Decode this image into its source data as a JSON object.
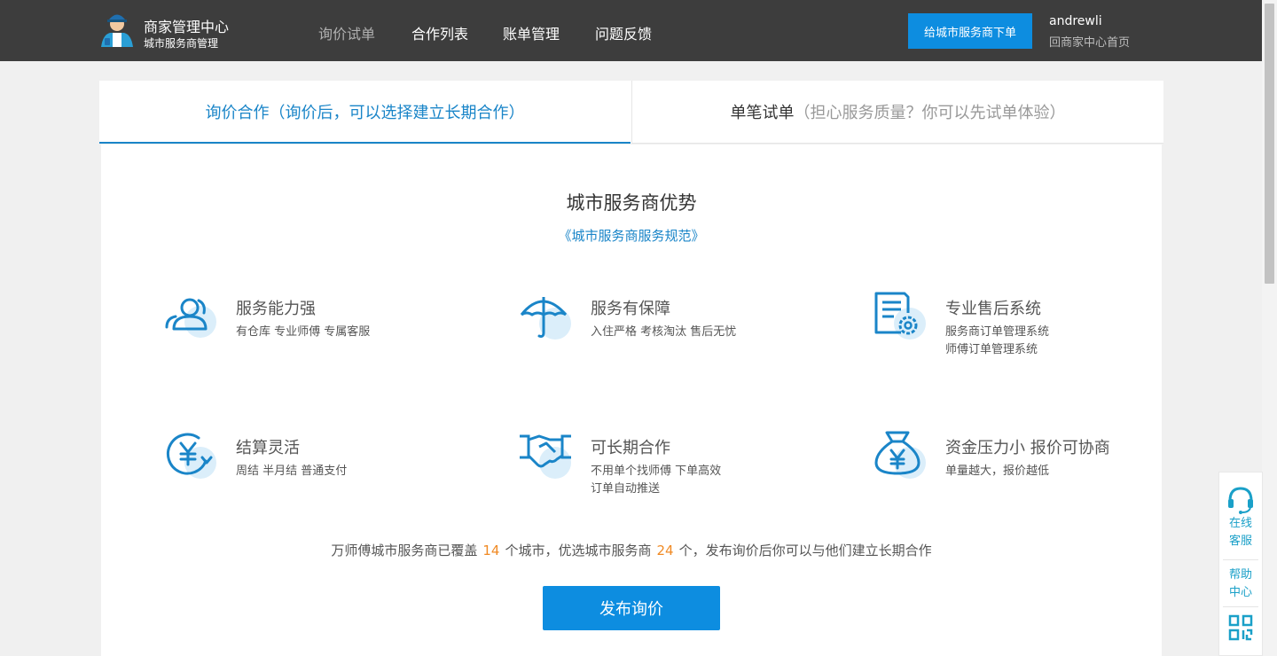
{
  "header": {
    "brand_title": "商家管理中心",
    "brand_subtitle": "城市服务商管理",
    "nav": [
      "询价试单",
      "合作列表",
      "账单管理",
      "问题反馈"
    ],
    "order_button": "给城市服务商下单",
    "username": "andrewli",
    "home_link": "回商家中心首页"
  },
  "tabs": [
    {
      "label": "询价合作（询价后，可以选择建立长期合作）",
      "note": ""
    },
    {
      "label": "单笔试单",
      "note": "（担心服务质量？你可以先试单体验）"
    }
  ],
  "panel": {
    "title": "城市服务商优势",
    "link": "《城市服务商服务规范》",
    "features": [
      {
        "icon": "users-icon",
        "title": "服务能力强",
        "desc": [
          "有仓库   专业师傅   专属客服"
        ]
      },
      {
        "icon": "umbrella-icon",
        "title": "服务有保障",
        "desc": [
          "入住严格   考核淘汰   售后无忧"
        ]
      },
      {
        "icon": "document-gear-icon",
        "title": "专业售后系统",
        "desc": [
          "服务商订单管理系统",
          "师傅订单管理系统"
        ]
      },
      {
        "icon": "yen-refresh-icon",
        "title": "结算灵活",
        "desc": [
          "周结   半月结   普通支付"
        ]
      },
      {
        "icon": "handshake-icon",
        "title": "可长期合作",
        "desc": [
          "不用单个找师傅   下单高效",
          "订单自动推送"
        ]
      },
      {
        "icon": "money-bag-icon",
        "title": "资金压力小 报价可协商",
        "desc": [
          "单量越大，报价越低"
        ]
      }
    ],
    "stats": {
      "part1": "万师傅城市服务商已覆盖",
      "cities": "14",
      "part2": "个城市，优选城市服务商",
      "providers": "24",
      "part3": "个，发布询价后你可以与他们建立长期合作"
    },
    "publish_button": "发布询价"
  },
  "float": {
    "online_service": [
      "在线",
      "客服"
    ],
    "help_center": [
      "帮助",
      "中心"
    ],
    "qr_icon": "qrcode-icon"
  },
  "colors": {
    "header_bg": "#3d3d3d",
    "accent": "#1a85c8",
    "button": "#0d8de0",
    "highlight": "#f08a24",
    "icon_bg": "#dbeefa"
  }
}
